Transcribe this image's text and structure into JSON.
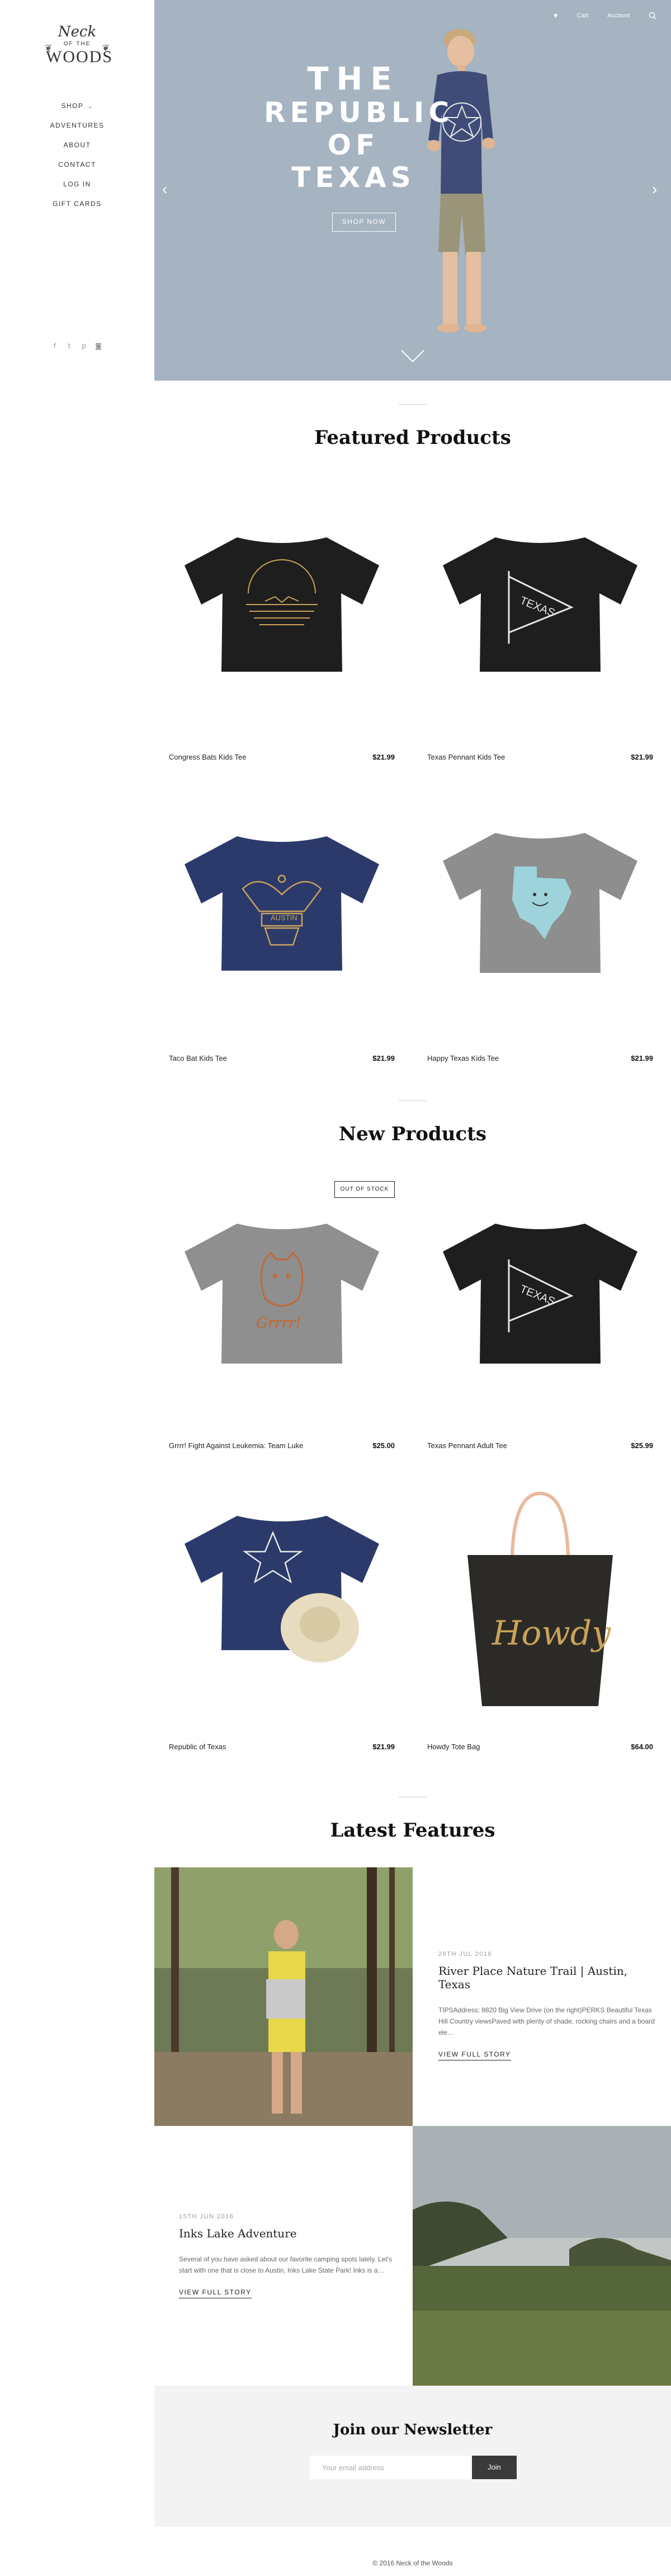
{
  "brand": {
    "logo_line1": "Neck",
    "logo_line2": "OF THE",
    "logo_line3": "WOODS"
  },
  "nav": {
    "items": [
      {
        "label": "SHOP",
        "chevron": "⌄"
      },
      {
        "label": "ADVENTURES"
      },
      {
        "label": "ABOUT"
      },
      {
        "label": "CONTACT"
      },
      {
        "label": "LOG IN"
      },
      {
        "label": "GIFT CARDS"
      }
    ]
  },
  "social": {
    "icons": [
      "facebook-icon",
      "twitter-icon",
      "pinterest-icon",
      "instagram-icon"
    ],
    "glyphs": [
      "f",
      "t",
      "p",
      "◙"
    ]
  },
  "topbar": {
    "heart": "♥",
    "cart": "Cart",
    "account": "Account"
  },
  "hero": {
    "title_line1": "THE",
    "title_line2": "REPUBLIC",
    "title_line3": "OF",
    "title_line4": "TEXAS",
    "button": "SHOP NOW",
    "prev": "‹",
    "next": "›",
    "bg_color": "#a6b3c1"
  },
  "featured": {
    "title": "Featured Products",
    "products": [
      {
        "name": "Congress Bats Kids Tee",
        "price": "$21.99"
      },
      {
        "name": "Texas Pennant Kids Tee",
        "price": "$21.99"
      },
      {
        "name": "Taco Bat Kids Tee",
        "price": "$21.99"
      },
      {
        "name": "Happy Texas Kids Tee",
        "price": "$21.99"
      }
    ]
  },
  "new_products": {
    "title": "New Products",
    "badge": "OUT OF STOCK",
    "products": [
      {
        "name": "Grrrr! Fight Against Leukemia: Team Luke",
        "price": "$25.00"
      },
      {
        "name": "Texas Pennant Adult Tee",
        "price": "$25.99"
      },
      {
        "name": "Republic of Texas",
        "price": "$21.99"
      },
      {
        "name": "Howdy Tote Bag",
        "price": "$64.00"
      }
    ]
  },
  "features": {
    "title": "Latest Features",
    "items": [
      {
        "date": "26TH JUL 2016",
        "title": "River Place Nature Trail | Austin, Texas",
        "excerpt": "TIPSAddress: 8820 Big View Drive (on the right)PERKS Beautiful Texas Hill Country viewsPaved with plenty of shade, rocking chairs and a board ele…",
        "link": "VIEW FULL STORY"
      },
      {
        "date": "15TH JUN 2016",
        "title": "Inks Lake Adventure",
        "excerpt": "Several of you have asked about our favorite camping spots lately. Let's start with one that is close to Austin, Inks Lake State Park! Inks is a…",
        "link": "VIEW FULL STORY"
      }
    ]
  },
  "newsletter": {
    "title": "Join our Newsletter",
    "placeholder": "Your email address",
    "button": "Join"
  },
  "footer": {
    "copyright": "© 2016 Neck of the Woods"
  },
  "colors": {
    "navy": "#2c3a6b",
    "black_tee": "#1e1e1e",
    "grey_tee": "#8e8e8e",
    "gold": "#c9a35a",
    "tote": "#2b2a26"
  }
}
